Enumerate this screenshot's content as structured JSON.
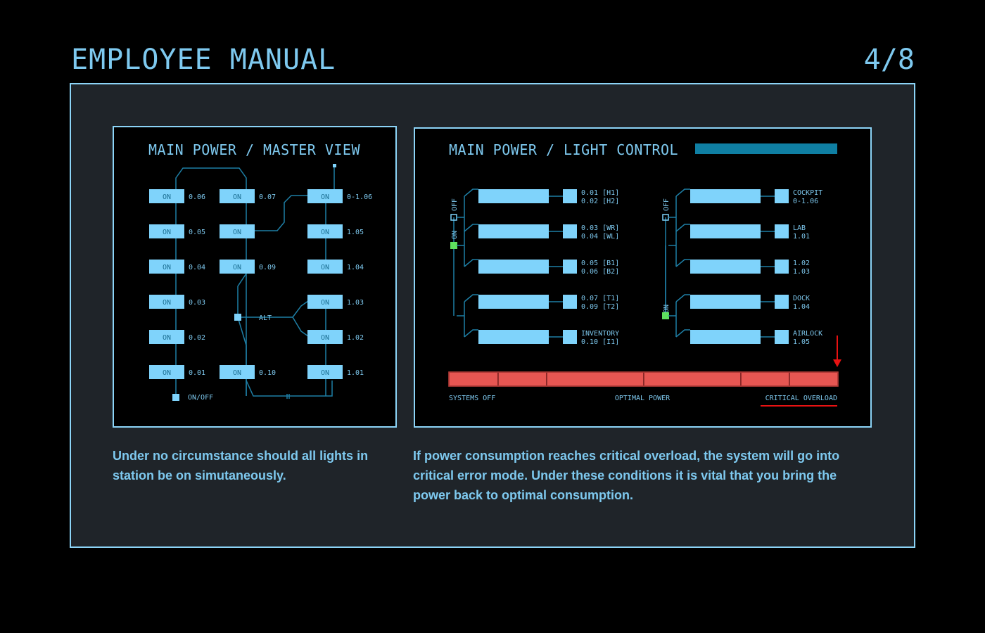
{
  "header": {
    "title": "EMPLOYEE MANUAL",
    "page": "4/8"
  },
  "master": {
    "title": "MAIN POWER / MASTER VIEW",
    "switches": [
      {
        "label": "ON",
        "code": "0.06"
      },
      {
        "label": "ON",
        "code": "0.05"
      },
      {
        "label": "ON",
        "code": "0.04"
      },
      {
        "label": "ON",
        "code": "0.03"
      },
      {
        "label": "ON",
        "code": "0.02"
      },
      {
        "label": "ON",
        "code": "0.01"
      },
      {
        "label": "ON",
        "code": "0.07"
      },
      {
        "label": "ON",
        "code": ""
      },
      {
        "label": "ON",
        "code": "0.09"
      },
      {
        "label": "ON",
        "code": "0.10"
      },
      {
        "label": "ON",
        "code": "0-1.06"
      },
      {
        "label": "ON",
        "code": "1.05"
      },
      {
        "label": "ON",
        "code": "1.04"
      },
      {
        "label": "ON",
        "code": "1.03"
      },
      {
        "label": "ON",
        "code": "1.02"
      },
      {
        "label": "ON",
        "code": "1.01"
      }
    ],
    "alt_label": "ALT",
    "onoff_label": "ON/OFF"
  },
  "light": {
    "title": "MAIN POWER / LIGHT CONTROL",
    "left_labels": {
      "off": "OFF",
      "on": "ON"
    },
    "right_labels": {
      "off": "OFF",
      "on": "ON"
    },
    "left_rows": [
      {
        "line1": "0.01 [H1]",
        "line2": "0.02 [H2]"
      },
      {
        "line1": "0.03 [WR]",
        "line2": "0.04 [WL]"
      },
      {
        "line1": "0.05 [B1]",
        "line2": "0.06 [B2]"
      },
      {
        "line1": "0.07 [T1]",
        "line2": "0.09 [T2]"
      },
      {
        "line1": "INVENTORY",
        "line2": "0.10 [I1]"
      }
    ],
    "right_rows": [
      {
        "line1": "COCKPIT",
        "line2": "0-1.06"
      },
      {
        "line1": "LAB",
        "line2": "1.01"
      },
      {
        "line1": "1.02",
        "line2": "1.03"
      },
      {
        "line1": "DOCK",
        "line2": "1.04"
      },
      {
        "line1": "AIRLOCK",
        "line2": "1.05"
      }
    ],
    "meter": {
      "segments": 6,
      "labels": {
        "left": "SYSTEMS OFF",
        "middle": "OPTIMAL POWER",
        "right": "CRITICAL OVERLOAD"
      }
    }
  },
  "captions": {
    "left": "Under no circumstance should all lights in station be on simutaneously.",
    "right": "If power consumption reaches critical overload, the system will go into critical error mode. Under these conditions it is vital that you bring the power back to optimal  consumption."
  },
  "colors": {
    "accent": "#7ec9ef",
    "button": "#7fd3fb",
    "wire": "#1e7fa6",
    "on_indicator": "#5ee05e",
    "meter_fill": "#e65652",
    "alert": "#e81212",
    "status_bar": "#0f7fa3"
  }
}
